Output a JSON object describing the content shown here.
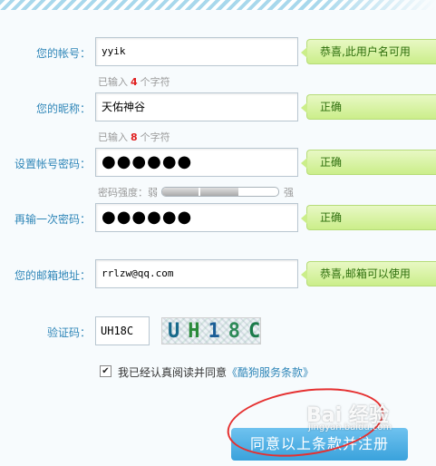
{
  "fields": {
    "username": {
      "label": "您的帐号：",
      "value": "yyik",
      "tip": "恭喜,此用户名可用",
      "hint_prefix": "已输入",
      "hint_count": "4",
      "hint_suffix": "个字符"
    },
    "nickname": {
      "label": "您的昵称：",
      "value": "天佑神谷",
      "tip": "正确",
      "hint_prefix": "已输入",
      "hint_count": "8",
      "hint_suffix": "个字符"
    },
    "password": {
      "label": "设置帐号密码：",
      "value": "●●●●●●",
      "tip": "正确"
    },
    "strength": {
      "label": "密码强度：弱",
      "strong": "强",
      "level": 0.66
    },
    "confirm": {
      "label": "再输一次密码：",
      "value": "●●●●●●",
      "tip": "正确"
    },
    "email": {
      "label": "您的邮箱地址：",
      "value": "rrlzw@qq.com",
      "tip": "恭喜,邮箱可以使用"
    },
    "captcha": {
      "label": "验证码：",
      "value": "UH18C",
      "image_chars": [
        "U",
        "H",
        "1",
        "8",
        "C"
      ]
    }
  },
  "agreement": {
    "text": "我已经认真阅读并同意",
    "link": "《酷狗服务条款》",
    "checked": "✔"
  },
  "submit_label": "同意以上条款并注册",
  "watermark": {
    "brand": "Bai 经验",
    "url": "jingyan.baidu.com"
  },
  "colors": {
    "label": "#2f86b8",
    "tip_bg": "#cbee8a",
    "hint_count": "#e02020",
    "button": "#3aa2dc"
  }
}
